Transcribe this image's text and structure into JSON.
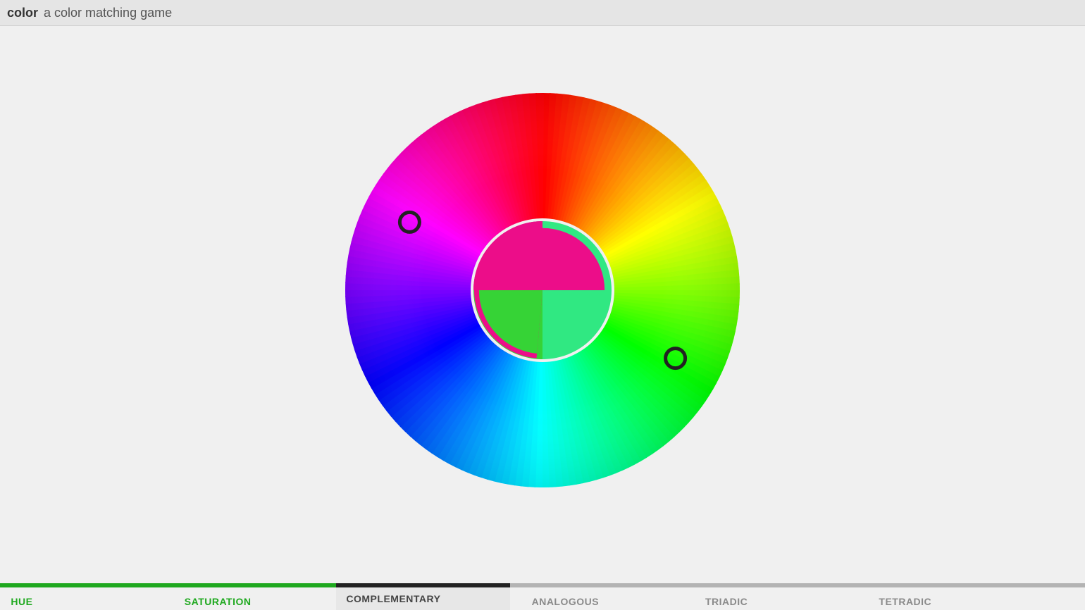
{
  "header": {
    "title": "color",
    "subtitle": "a color matching game"
  },
  "game": {
    "mode": "COMPLEMENTARY",
    "wheel_radius": 280,
    "inner_hole_radius": 98,
    "picker_angle_a_deg": 137,
    "picker_angle_b_deg": 337,
    "picker_radius": 230,
    "target": {
      "color_a": "#ec0d89",
      "color_b": "#30e882"
    },
    "current": {
      "color_a": "#30e882",
      "color_b": "#ec0d89"
    },
    "center_bg": "#f0f0f0"
  },
  "footer": {
    "levels": [
      "HUE",
      "SATURATION",
      "COMPLEMENTARY",
      "ANALOGOUS",
      "TRIADIC",
      "TETRADIC"
    ],
    "completed": 2,
    "active_index": 2,
    "progress_green_pct": 31,
    "active_tab_left_pct": 31,
    "active_tab_width_pct": 16
  },
  "colors": {
    "accent_green": "#1ea81e",
    "muted": "#8a8a8a",
    "track": "#b3b3b3",
    "active_bar": "#222"
  }
}
